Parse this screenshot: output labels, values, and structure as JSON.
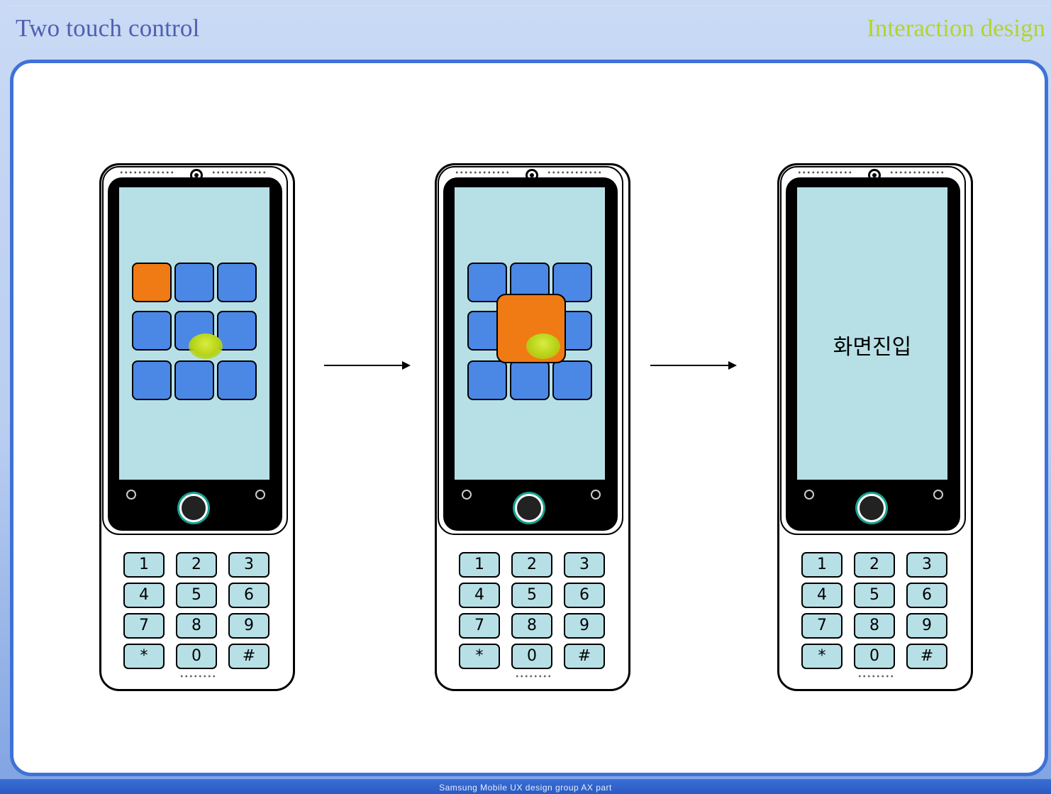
{
  "header": {
    "title": "Two touch control",
    "category": "Interaction design"
  },
  "footer": {
    "text": "Samsung Mobile UX design group AX part"
  },
  "keypad_keys": [
    "1",
    "2",
    "3",
    "4",
    "5",
    "6",
    "7",
    "8",
    "9",
    "*",
    "0",
    "#"
  ],
  "steps": [
    {
      "state": "tile-highlighted"
    },
    {
      "state": "tile-enlarged"
    },
    {
      "state": "screen-entered",
      "screen_label": "화면진입"
    }
  ],
  "colors": {
    "tile": "#4b87e5",
    "tile_selected": "#f07a14",
    "screen": "#b7e0e6",
    "touch_point": "#b6d317",
    "accent_title": "#4f5fb0",
    "accent_category": "#b4d42a",
    "frame": "#3f72d8"
  }
}
